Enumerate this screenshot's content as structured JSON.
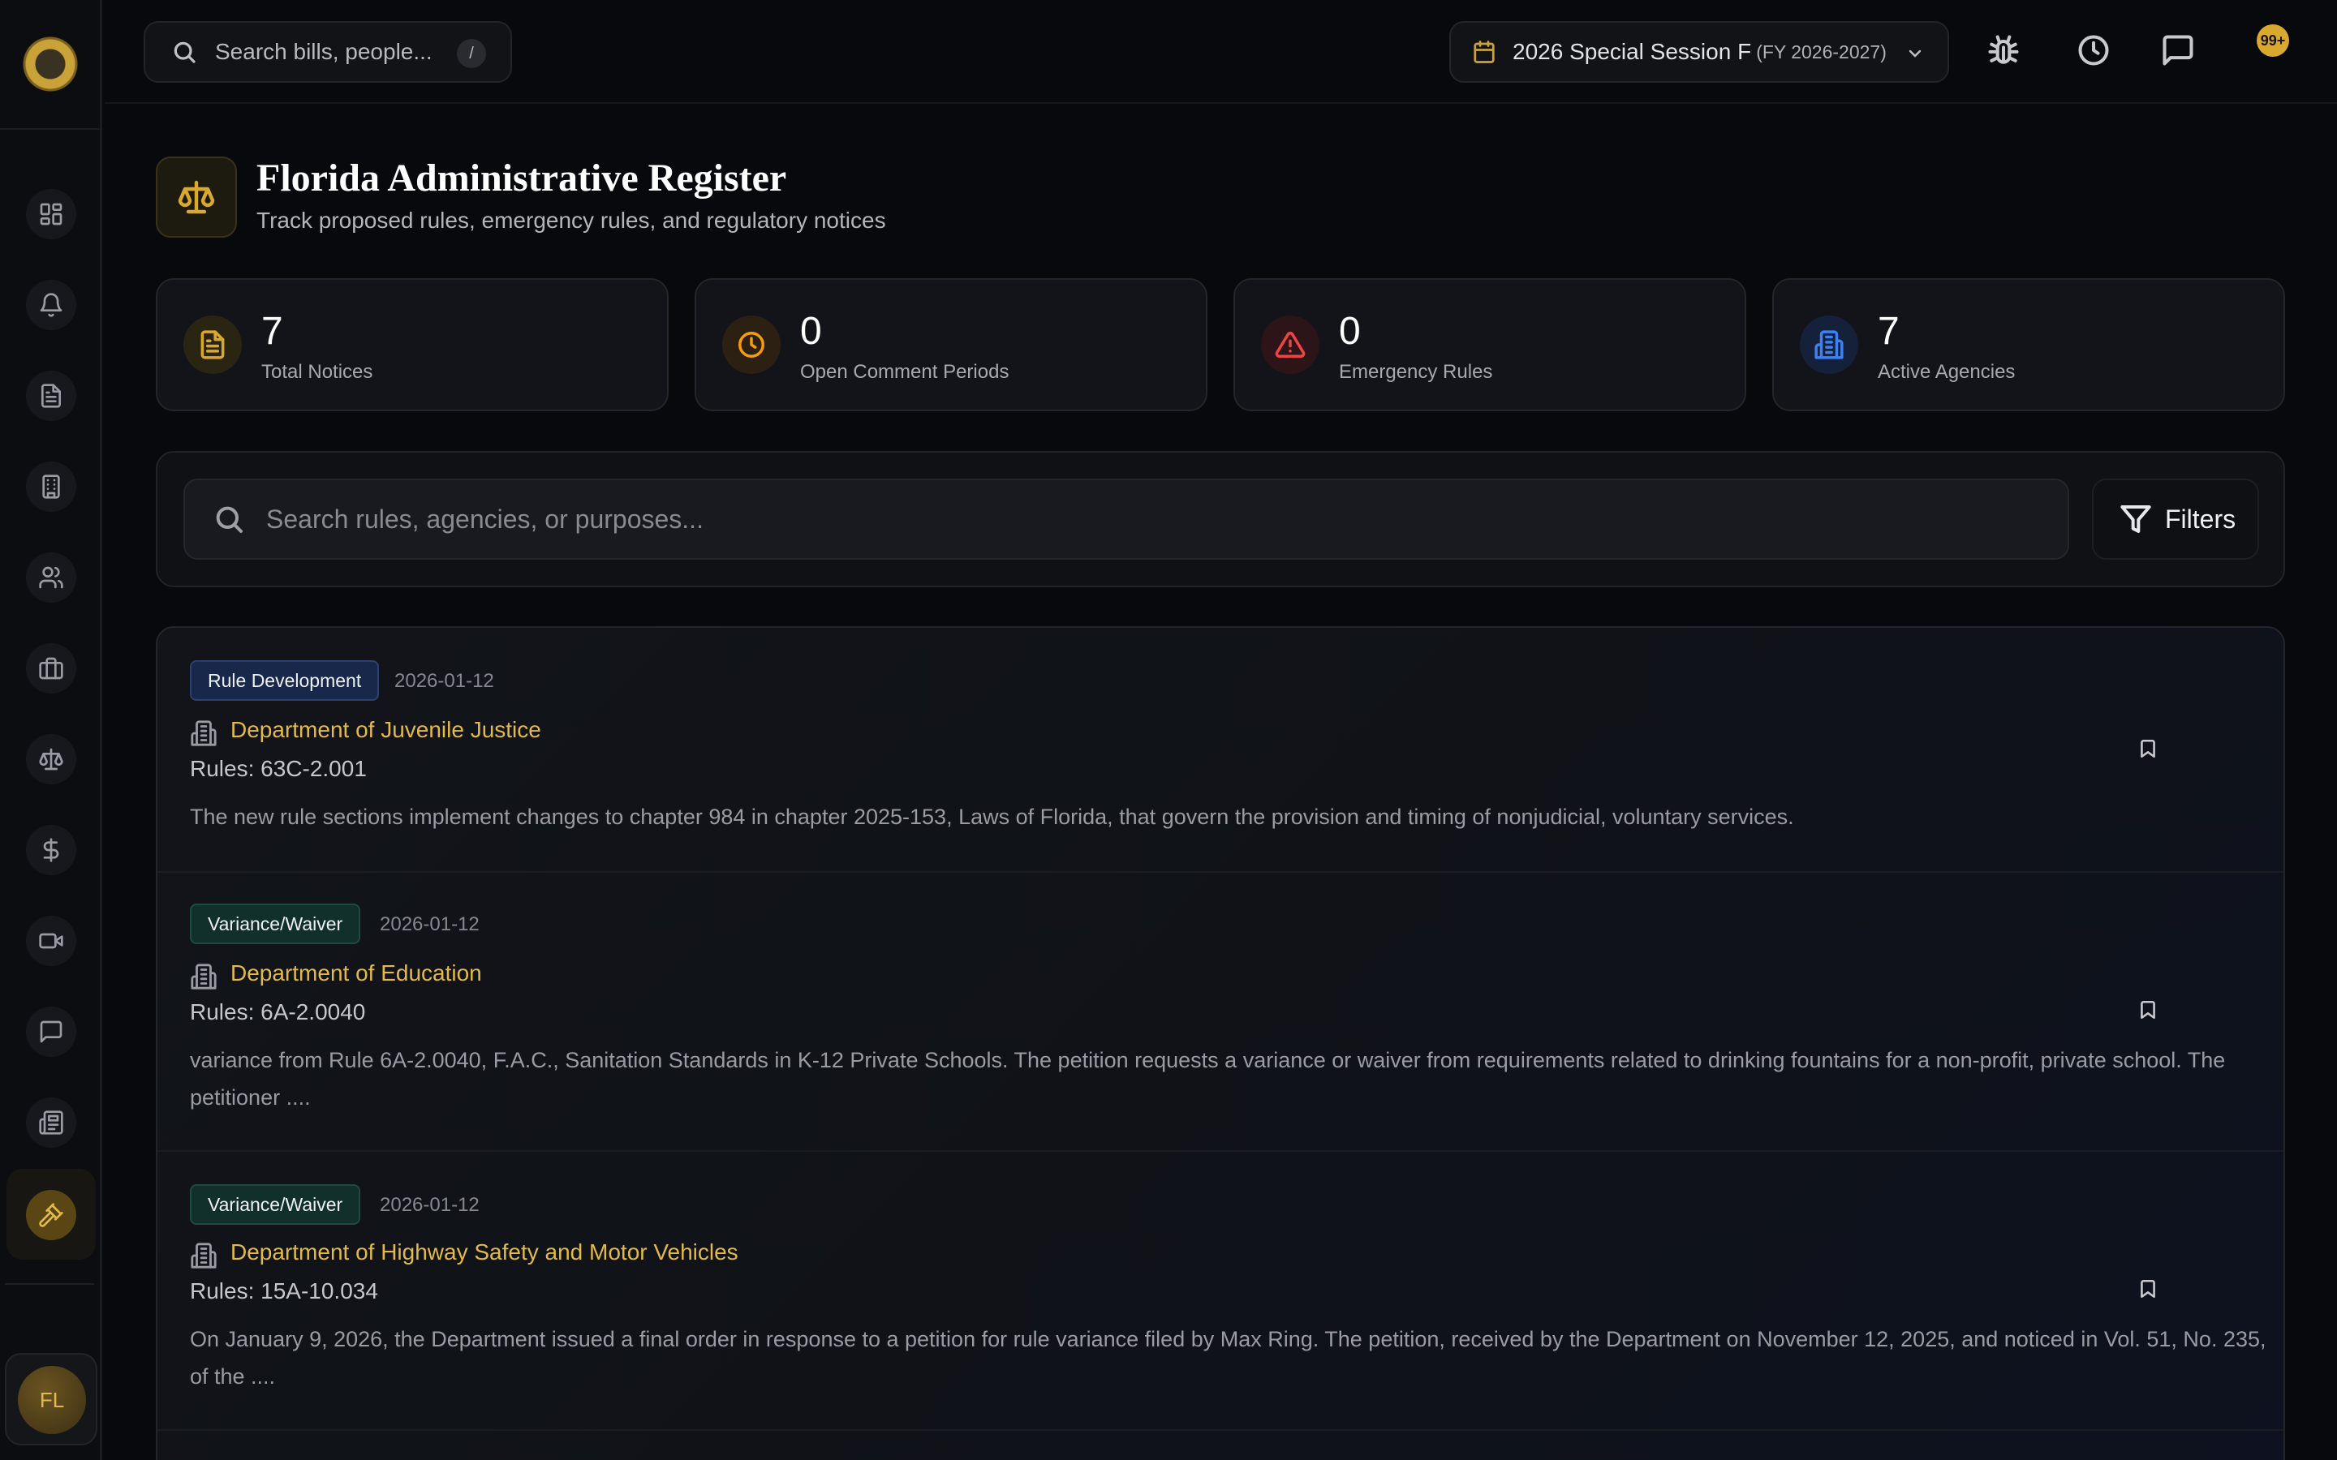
{
  "topbar": {
    "search_placeholder": "Search bills, people...",
    "search_shortcut": "/",
    "session_label": "2026 Special Session F",
    "session_fy": "(FY 2026-2027)",
    "notification_count": "99+"
  },
  "sidebar": {
    "user_initials": "FL"
  },
  "header": {
    "title": "Florida Administrative Register",
    "subtitle": "Track proposed rules, emergency rules, and regulatory notices"
  },
  "stats": [
    {
      "value": "7",
      "label": "Total Notices",
      "color": "#d9a82e"
    },
    {
      "value": "0",
      "label": "Open Comment Periods",
      "color": "#f59e0b"
    },
    {
      "value": "0",
      "label": "Emergency Rules",
      "color": "#ef4444"
    },
    {
      "value": "7",
      "label": "Active Agencies",
      "color": "#3b82f6"
    }
  ],
  "search": {
    "placeholder": "Search rules, agencies, or purposes...",
    "filters_label": "Filters"
  },
  "notices": [
    {
      "type": "Rule Development",
      "date": "2026-01-12",
      "agency": "Department of Juvenile Justice",
      "rules": "Rules: 63C-2.001",
      "description": "The new rule sections implement changes to chapter 984 in chapter 2025-153, Laws of Florida, that govern the provision and timing of nonjudicial, voluntary services."
    },
    {
      "type": "Variance/Waiver",
      "date": "2026-01-12",
      "agency": "Department of Education",
      "rules": "Rules: 6A-2.0040",
      "description": "variance from Rule 6A-2.0040, F.A.C., Sanitation Standards in K-12 Private Schools. The petition requests a variance or waiver from requirements related to drinking fountains for a non-profit, private school. The petitioner ...."
    },
    {
      "type": "Variance/Waiver",
      "date": "2026-01-12",
      "agency": "Department of Highway Safety and Motor Vehicles",
      "rules": "Rules: 15A-10.034",
      "description": "On January 9, 2026, the Department issued a final order in response to a petition for rule variance filed by Max Ring. The petition, received by the Department on November 12, 2025, and noticed in Vol. 51, No. 235, of the ...."
    }
  ]
}
